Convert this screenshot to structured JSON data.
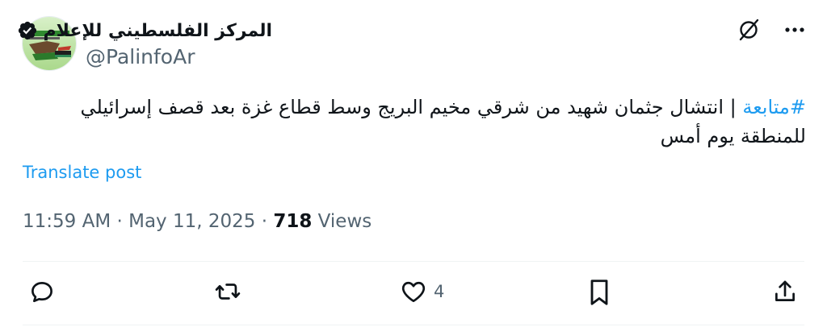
{
  "account": {
    "display_name": "المركز الفلسطيني للإعلام",
    "handle": "@PalinfoAr",
    "avatar_icon": "palinfo-logo",
    "verified_icon": "verified-badge-icon"
  },
  "header_icons": {
    "grok": "grok-icon",
    "more": "more-options-icon"
  },
  "tweet": {
    "hashtag": "#متابعة",
    "body": " | انتشال جثمان شهيد من شرقي مخيم البريج وسط قطاع غزة بعد قصف إسرائيلي للمنطقة يوم أمس"
  },
  "translate_label": "Translate post",
  "meta": {
    "time": "11:59 AM",
    "date": "May 11, 2025",
    "separator": " · ",
    "views_count": "718",
    "views_label": "Views"
  },
  "actions": {
    "reply": {
      "icon": "reply-icon",
      "count": ""
    },
    "retweet": {
      "icon": "retweet-icon",
      "count": ""
    },
    "like": {
      "icon": "like-icon",
      "count": "4"
    },
    "bookmark": {
      "icon": "bookmark-icon",
      "count": ""
    },
    "share": {
      "icon": "share-icon",
      "count": ""
    }
  },
  "colors": {
    "link": "#1d9bf0",
    "text": "#0f1419",
    "secondary": "#536471",
    "divider": "#eff3f4"
  }
}
